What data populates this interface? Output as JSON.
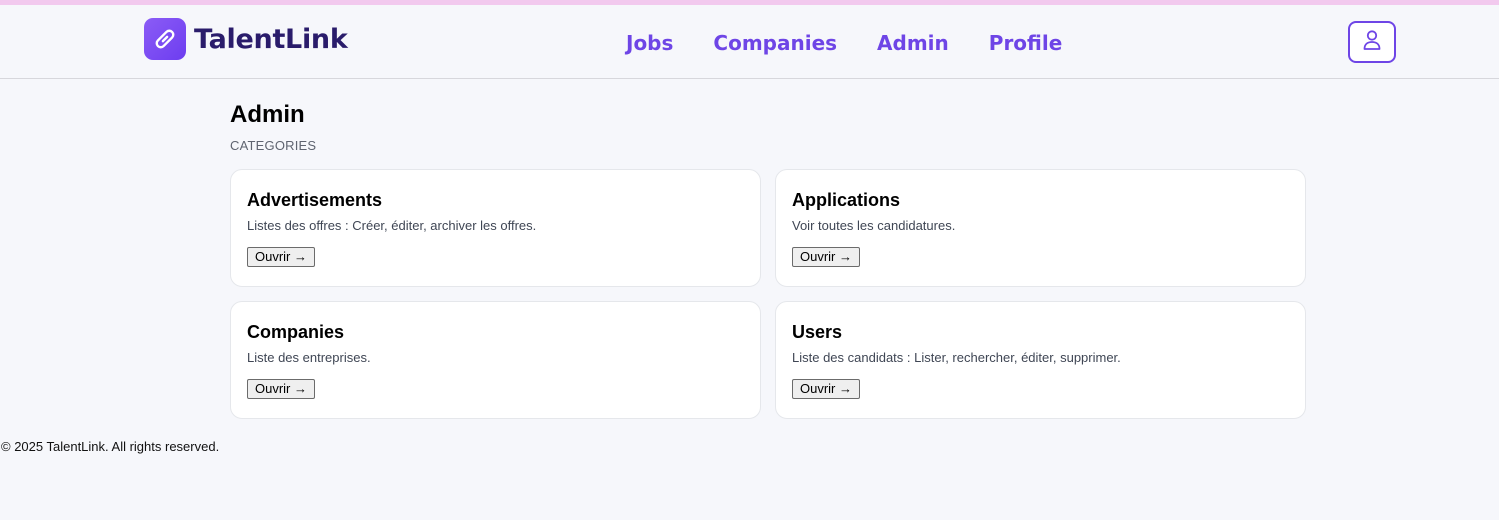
{
  "app": {
    "brand": "TalentLink",
    "brand_color": "#6e45e6"
  },
  "nav": {
    "items": [
      {
        "label": "Jobs"
      },
      {
        "label": "Companies"
      },
      {
        "label": "Admin"
      },
      {
        "label": "Profile"
      }
    ],
    "profile_icon": "user-icon"
  },
  "main": {
    "title": "Admin",
    "section_label": "CATEGORIES",
    "cards": [
      {
        "title": "Advertisements",
        "description": "Listes des offres : Créer, éditer, archiver les offres.",
        "button": "Ouvrir →"
      },
      {
        "title": "Applications",
        "description": "Voir toutes les candidatures.",
        "button": "Ouvrir →"
      },
      {
        "title": "Companies",
        "description": "Liste des entreprises.",
        "button": "Ouvrir →"
      },
      {
        "title": "Users",
        "description": "Liste des candidats : Lister, rechercher, éditer, supprimer.",
        "button": "Ouvrir →"
      }
    ]
  },
  "footer": {
    "text": "© 2025 TalentLink. All rights reserved."
  }
}
